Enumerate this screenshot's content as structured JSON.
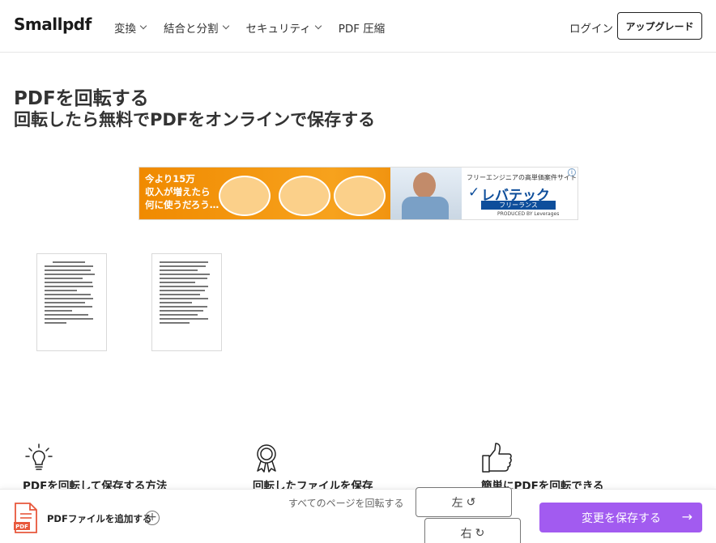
{
  "header": {
    "logo": "Smallpdf",
    "nav": [
      {
        "label": "変換"
      },
      {
        "label": "結合と分割"
      },
      {
        "label": "セキュリティ"
      },
      {
        "label": "PDF 圧縮"
      }
    ],
    "login": "ログイン",
    "upgrade": "アップグレード"
  },
  "main": {
    "title": "PDFを回転する",
    "subtitle": "回転したら無料でPDFをオンラインで保存する"
  },
  "ad": {
    "left_line1": "今より15万",
    "left_line2": "収入が増えたら",
    "left_line3": "何に使うだろう…",
    "right_tagline": "フリーエンジニアの高単価案件サイト",
    "brand": "レバテック",
    "brand_sub": "フリーランス",
    "produced_by": "PRODUCED BY Leverages"
  },
  "features": [
    {
      "label": "PDFを回転して保存する方法",
      "icon": "lightbulb-icon"
    },
    {
      "label": "回転したファイルを保存",
      "icon": "award-ribbon-icon"
    },
    {
      "label": "簡単にPDFを回転できる",
      "icon": "thumbs-up-icon"
    }
  ],
  "bottombar": {
    "add_pdf": "PDFファイルを追加する",
    "rotate_all": "すべてのページを回転する",
    "left": "左",
    "right": "右",
    "save": "変更を保存する"
  },
  "colors": {
    "accent": "#a25bf0",
    "ad_orange": "#f08a00",
    "pdf_icon": "#e8583c"
  }
}
